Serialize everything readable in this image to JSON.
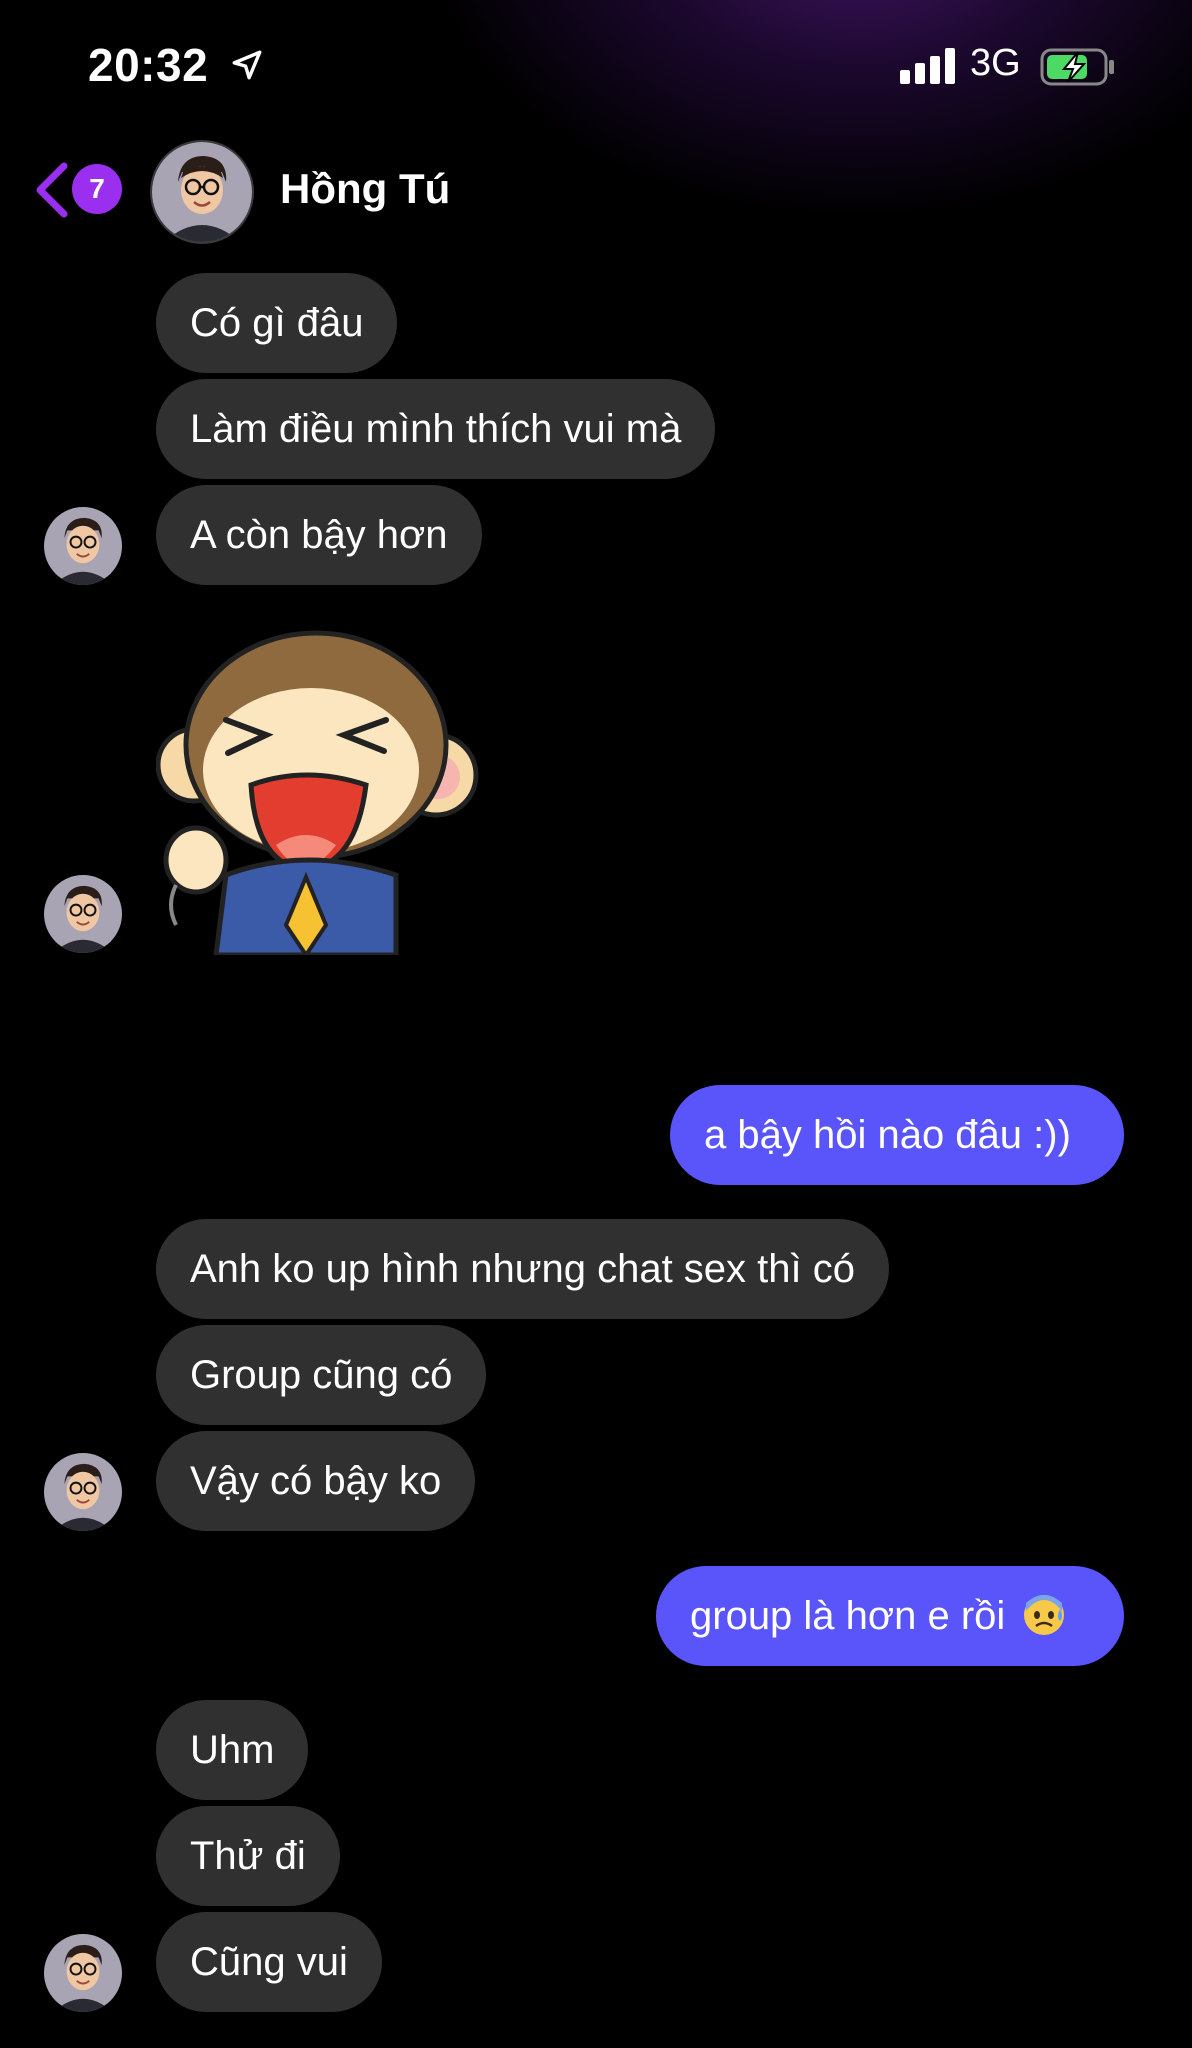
{
  "status_bar": {
    "time": "20:32",
    "network": "3G",
    "icons": [
      "location-arrow-icon",
      "signal-bars-icon",
      "battery-charging-icon"
    ]
  },
  "header": {
    "back_badge_count": "7",
    "contact_name": "Hồng Tú"
  },
  "messages": [
    {
      "from": "them",
      "text": "Có gì đâu"
    },
    {
      "from": "them",
      "text": "Làm điều mình thích vui mà"
    },
    {
      "from": "them",
      "text": "A còn bậy hơn"
    },
    {
      "from": "them",
      "type": "sticker",
      "sticker": "laughing-monkey-sticker"
    },
    {
      "from": "me",
      "text": "a bậy hồi nào đâu :))"
    },
    {
      "from": "them",
      "text": "Anh ko up hình nhưng chat sex thì có"
    },
    {
      "from": "them",
      "text": "Group cũng có"
    },
    {
      "from": "them",
      "text": "Vậy có bậy ko"
    },
    {
      "from": "me",
      "text": "group là hơn e rồi",
      "emoji": "anxious-face-with-sweat-icon"
    },
    {
      "from": "them",
      "text": "Uhm"
    },
    {
      "from": "them",
      "text": "Thử đi"
    },
    {
      "from": "them",
      "text": "Cũng vui"
    }
  ],
  "colors": {
    "background": "#000000",
    "incoming_bubble": "#303030",
    "outgoing_bubble": "#5a54fb",
    "accent": "#9b2ff0"
  }
}
